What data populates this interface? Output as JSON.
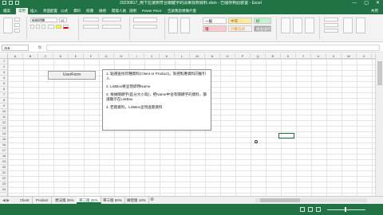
{
  "window": {
    "title": "20230817_用下拉選到符合關鍵字的清單找到資料.xlsm - 已儲存到此裝置 - Excel",
    "controls": [
      "—",
      "▢",
      "✕"
    ]
  },
  "ribbon": {
    "tabs": [
      "檔案",
      "常用",
      "插入",
      "頁面配置",
      "公式",
      "資料",
      "校閱",
      "檢視",
      "開發人員",
      "說明",
      "Power Pivot",
      "告訴我您想做什麼"
    ],
    "active_tab": "常用",
    "share": "共用",
    "font_name": "新細明體",
    "font_size": "12",
    "styles": {
      "normal": "一般",
      "neutral": "中等",
      "good": "好",
      "bad": "壞",
      "calc": "計算方式",
      "check": "檢查儲存格"
    }
  },
  "formula_bar": {
    "name_box": "J16",
    "fx": "fx",
    "formula": ""
  },
  "grid": {
    "columns": [
      "A",
      "B",
      "C",
      "D",
      "E",
      "F",
      "G",
      "H",
      "I",
      "J",
      "K",
      "L",
      "M",
      "N",
      "O",
      "P",
      "Q",
      "R",
      "S",
      "T",
      "U",
      "V",
      "W",
      "X"
    ],
    "rows": [
      "1",
      "2",
      "3",
      "4",
      "5",
      "6",
      "7",
      "8",
      "9",
      "10",
      "11",
      "12",
      "13",
      "14",
      "15",
      "16",
      "17",
      "18",
      "19",
      "20",
      "21",
      "22",
      "23",
      "24"
    ]
  },
  "sheet": {
    "button_label": "UserForm",
    "notes": [
      "1. 點選查找何種資料(Client or Product)，就把對應資料向動引入",
      "2. ListBox要呈現即時Name",
      "3. 根據關鍵字(區分大小寫)，把Name中含有關鍵字的資料，篩選顯示在ListBox",
      "4. 若無資料，ListBox呈現查無資料"
    ]
  },
  "sheet_tabs": {
    "tabs": [
      "Client",
      "Product",
      "想法版 25%",
      "單二版 25%",
      "單三版 50%",
      "練習版 10%"
    ],
    "active": "單二版 25%",
    "add": "⊕"
  }
}
